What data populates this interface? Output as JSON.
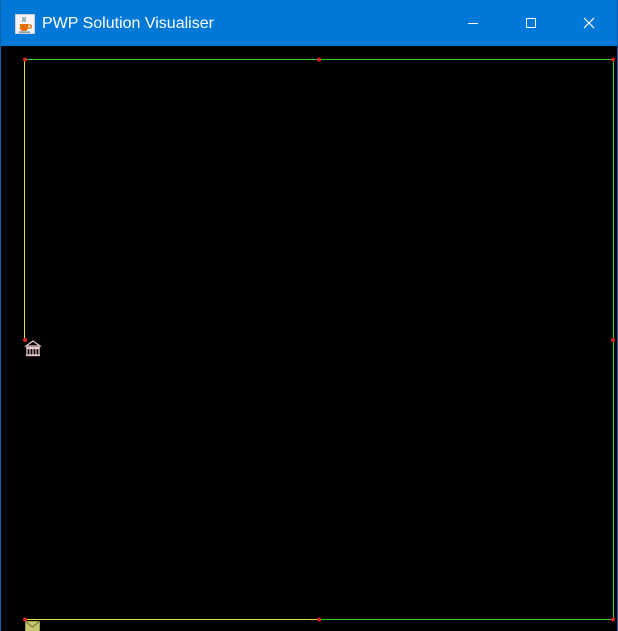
{
  "window": {
    "title": "PWP Solution Visualiser",
    "icon": "java-cup-icon",
    "controls": [
      "minimize-icon",
      "maximize-icon",
      "close-icon"
    ],
    "titlebar_color": "#0078d7"
  },
  "canvas": {
    "background": "#000000",
    "colors": {
      "path_green": "#2fd12f",
      "path_yellow": "#e8e040",
      "node_red": "#e02020",
      "depot_icon": "#e8c8c8",
      "envelope_icon": "#c8c870"
    },
    "icons": [
      "depot-building-icon",
      "envelope-icon"
    ]
  }
}
